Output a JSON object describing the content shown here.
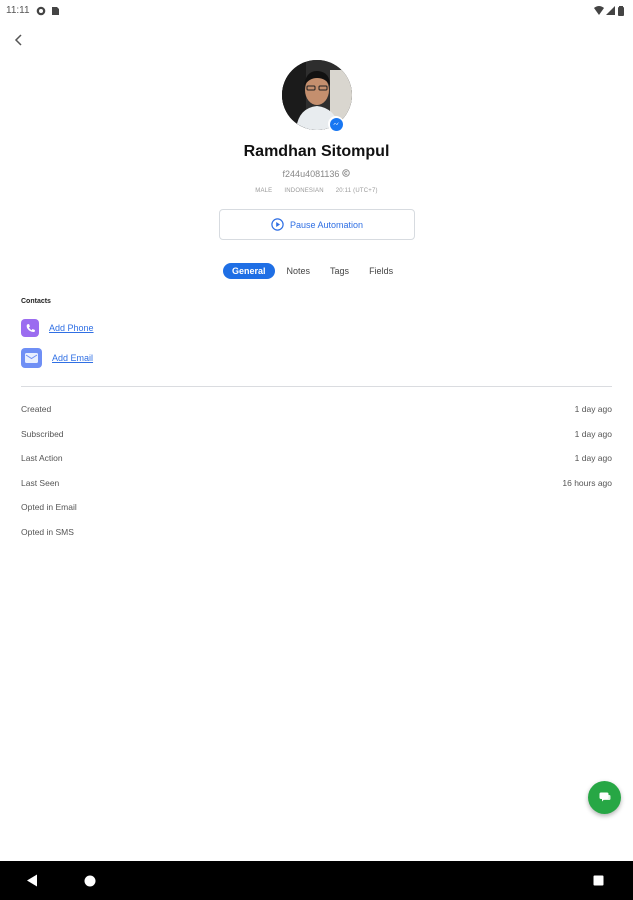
{
  "status_bar": {
    "time": "11:11"
  },
  "profile": {
    "name": "Ramdhan Sitompul",
    "user_id": "f244u4081136",
    "gender": "MALE",
    "locale": "INDONESIAN",
    "timezone": "20:11 (UTC+7)",
    "channel_icon": "messenger-icon"
  },
  "pause_button": {
    "label": "Pause Automation"
  },
  "tabs": [
    {
      "label": "General",
      "active": true
    },
    {
      "label": "Notes",
      "active": false
    },
    {
      "label": "Tags",
      "active": false
    },
    {
      "label": "Fields",
      "active": false
    }
  ],
  "contacts": {
    "title": "Contacts",
    "add_phone": "Add Phone",
    "add_email": "Add Email"
  },
  "info": [
    {
      "label": "Created",
      "value": "1 day ago"
    },
    {
      "label": "Subscribed",
      "value": "1 day ago"
    },
    {
      "label": "Last Action",
      "value": "1 day ago"
    },
    {
      "label": "Last Seen",
      "value": "16 hours ago"
    },
    {
      "label": "Opted in Email",
      "value": ""
    },
    {
      "label": "Opted in SMS",
      "value": ""
    }
  ],
  "colors": {
    "accent": "#1f6fe5",
    "link": "#2f6fe4",
    "phone_icon_bg": "#9b6cf0",
    "email_icon_bg": "#6f8ff5",
    "fab": "#27a745"
  }
}
